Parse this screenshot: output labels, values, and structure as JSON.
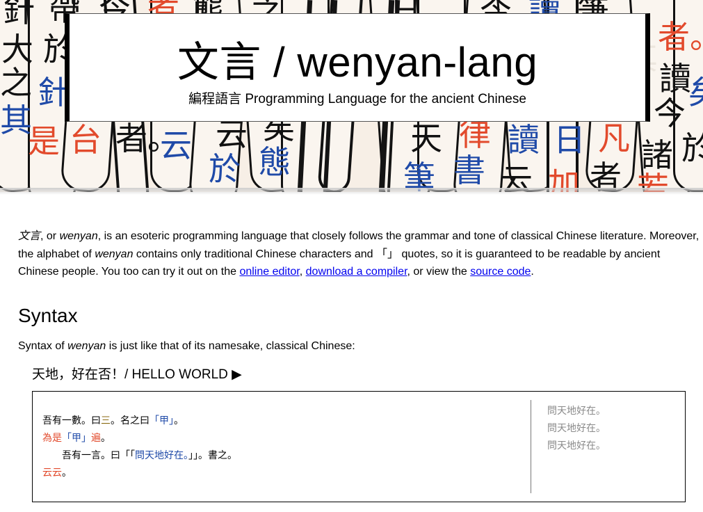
{
  "banner": {
    "title": "文言 / wenyan-lang",
    "subtitle": "編程語言 Programming Language for the ancient Chinese",
    "bg_glyphs": [
      "針",
      "帶",
      "今",
      "者",
      "態",
      "之",
      "日",
      "今",
      "讀",
      "筆",
      "者。",
      "大",
      "於",
      "之",
      "針",
      "其",
      "是",
      "今",
      "其",
      "讀",
      "矣",
      "今",
      "其",
      "是",
      "台",
      "者。",
      "云",
      "云",
      "矣",
      "態",
      "於",
      "天",
      "律",
      "讀",
      "日",
      "凡",
      "諸",
      "筆",
      "書",
      "云",
      "加",
      "者",
      "若",
      "於"
    ]
  },
  "intro": {
    "term_native": "文言",
    "s1": ", or ",
    "term_latin": "wenyan",
    "s2": ", is an esoteric programming language that closely follows the grammar and tone of classical Chinese literature. Moreover, the alphabet of ",
    "term_latin2": "wenyan",
    "s3": " contains only traditional Chinese characters and 「」 quotes, so it is guaranteed to be readable by ancient Chinese people. You too can try it out on the ",
    "link_editor": "online editor",
    "s4": ", ",
    "link_compiler": "download a compiler",
    "s5": ", or view the ",
    "link_source": "source code",
    "s6": "."
  },
  "syntax": {
    "heading": "Syntax",
    "desc_before": "Syntax of ",
    "desc_term": "wenyan",
    "desc_after": " is just like that of its namesake, classical Chinese:"
  },
  "example": {
    "title": "天地，好在否！/ HELLO WORLD ▶",
    "code_lines": [
      [
        {
          "t": "吾有一數。曰",
          "c": ""
        },
        {
          "t": "三",
          "c": "olive"
        },
        {
          "t": "。名之曰",
          "c": ""
        },
        {
          "t": "「甲」",
          "c": "blue"
        },
        {
          "t": "。",
          "c": ""
        }
      ],
      [
        {
          "t": "為是",
          "c": "red"
        },
        {
          "t": "「甲」",
          "c": "blue"
        },
        {
          "t": "遍",
          "c": "red"
        },
        {
          "t": "。",
          "c": ""
        }
      ],
      [
        {
          "t": "　　吾有一言。曰",
          "c": ""
        },
        {
          "t": "「「",
          "c": ""
        },
        {
          "t": "問天地好在。",
          "c": "blue"
        },
        {
          "t": "」」。書之。",
          "c": ""
        }
      ],
      [
        {
          "t": "云云",
          "c": "red"
        },
        {
          "t": "。",
          "c": ""
        }
      ]
    ],
    "output_lines": [
      "問天地好在。",
      "問天地好在。",
      "問天地好在。"
    ]
  },
  "colors": {
    "red": "#e24a2c",
    "blue": "#1f4aa8",
    "link": "#0000ee",
    "banner_bg": "#f7efe6"
  }
}
